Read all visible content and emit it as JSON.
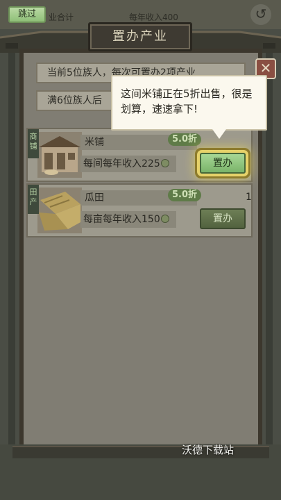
{
  "header": {
    "skip_label": "跳过",
    "faded_left_text": "业合计",
    "faded_income_text": "每年收入400",
    "back_icon": "back-arrow-icon"
  },
  "title": "置办产业",
  "info_rows": [
    "当前5位族人，每次可置办2项产业",
    "满6位族人后"
  ],
  "close_icon": "close-x-icon",
  "tooltip": {
    "text": "这间米铺正在5折出售，很是划算，速速拿下!"
  },
  "properties": [
    {
      "category": "商铺",
      "name": "米铺",
      "discount": "5.0折",
      "income": "每间每年收入225",
      "button": "置办",
      "highlighted": true
    },
    {
      "category": "田产",
      "name": "瓜田",
      "discount": "5.0折",
      "income": "每亩每年收入150",
      "button": "置办",
      "count_mark": "1",
      "highlighted": false
    }
  ],
  "watermark": "沃德下载站",
  "colors": {
    "highlight_ring": "#e6d26a",
    "buy_button": "#7ab46a",
    "close_button": "#8a4f42"
  }
}
